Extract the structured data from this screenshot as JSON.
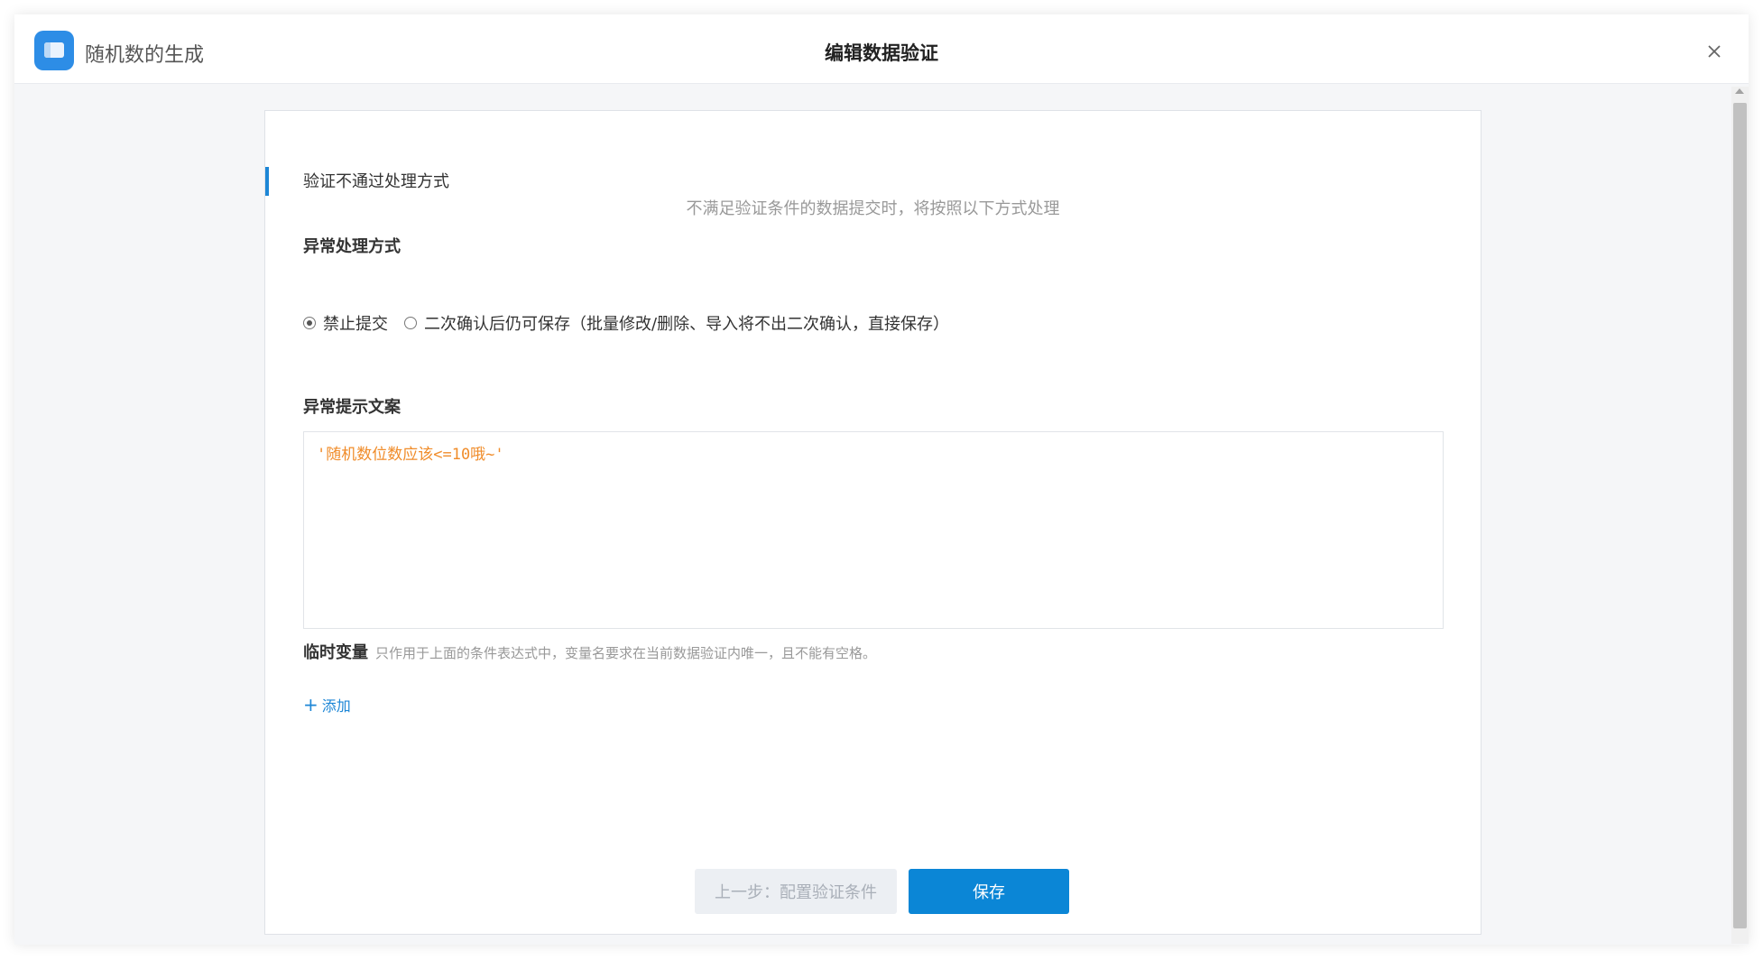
{
  "header": {
    "app_name": "随机数的生成",
    "title": "编辑数据验证",
    "icons": {
      "app": "app-window-icon",
      "close": "close-icon"
    }
  },
  "section": {
    "title": "验证不通过处理方式",
    "description": "不满足验证条件的数据提交时，将按照以下方式处理"
  },
  "exception_mode": {
    "label": "异常处理方式",
    "options": [
      {
        "label": "禁止提交",
        "checked": true
      },
      {
        "label": "二次确认后仍可保存（批量修改/删除、导入将不出二次确认，直接保存）",
        "checked": false
      }
    ]
  },
  "exception_message": {
    "label": "异常提示文案",
    "value": "'随机数位数应该<=10哦~'"
  },
  "temp_vars": {
    "label": "临时变量",
    "hint": "只作用于上面的条件表达式中，变量名要求在当前数据验证内唯一，且不能有空格。",
    "add_label": "添加"
  },
  "footer": {
    "prev_label": "上一步：配置验证条件",
    "save_label": "保存"
  },
  "colors": {
    "accent": "#1d86d6",
    "primary_button": "#0b86d6",
    "code_text": "#f08c2a"
  }
}
